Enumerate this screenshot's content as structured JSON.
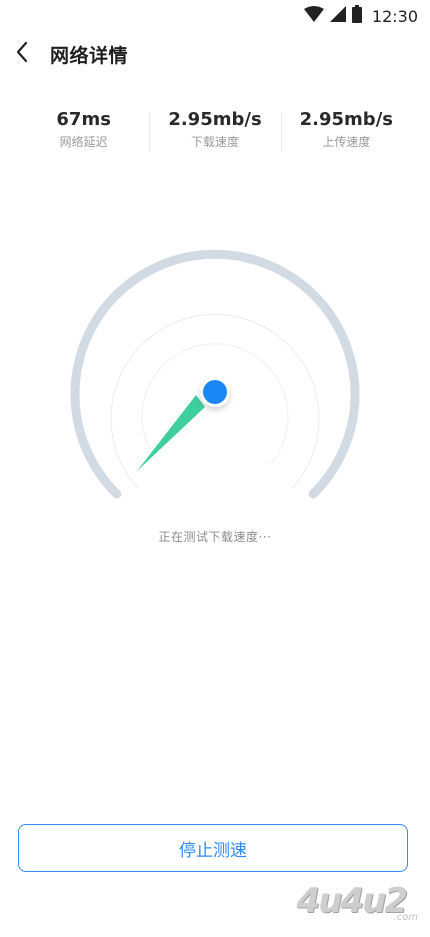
{
  "status_bar": {
    "time": "12:30",
    "icons": [
      "wifi-icon",
      "cellular-signal-icon",
      "battery-icon"
    ]
  },
  "header": {
    "back_icon": "chevron-left-icon",
    "title": "网络详情"
  },
  "stats": [
    {
      "value": "67ms",
      "label": "网络延迟"
    },
    {
      "value": "2.95mb/s",
      "label": "下载速度"
    },
    {
      "value": "2.95mb/s",
      "label": "上传速度"
    }
  ],
  "gauge": {
    "status_text": "正在测试下载速度···",
    "colors": {
      "outer_arc": "#d2dbe3",
      "inner_rings": "#e9ecef",
      "needle": "#3fcf9e",
      "hub": "#1b86f5"
    }
  },
  "actions": {
    "stop_label": "停止测速",
    "accent": "#2f8bf5"
  },
  "watermark": {
    "logo": "4u4u2",
    "domain": ".com"
  }
}
